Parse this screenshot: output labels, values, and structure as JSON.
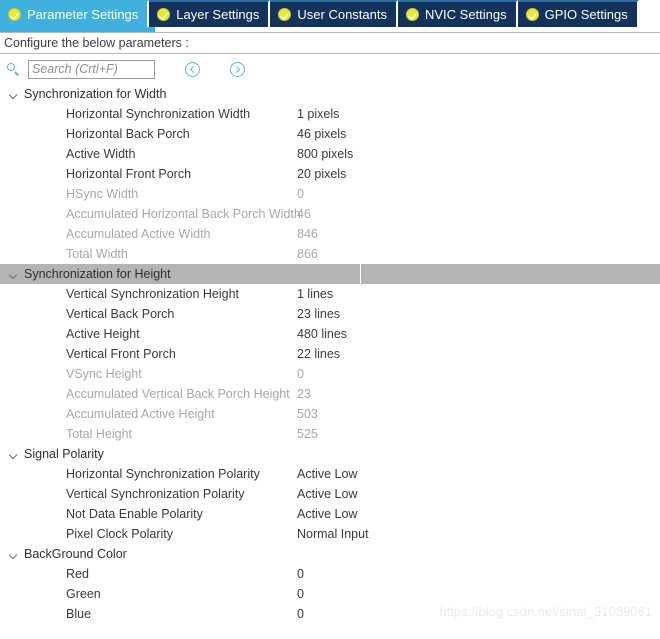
{
  "tabs": [
    {
      "label": "Parameter Settings",
      "active": true,
      "icon": "check-circle-icon"
    },
    {
      "label": "Layer Settings",
      "active": false,
      "icon": "check-circle-icon"
    },
    {
      "label": "User Constants",
      "active": false,
      "icon": "check-circle-icon"
    },
    {
      "label": "NVIC Settings",
      "active": false,
      "icon": "check-circle-icon"
    },
    {
      "label": "GPIO Settings",
      "active": false,
      "icon": "check-circle-icon"
    }
  ],
  "configure_bar": {
    "text": "Configure the below parameters :"
  },
  "search": {
    "placeholder": "Search (Crtl+F)",
    "value": "",
    "icon": "search-icon",
    "prev_icon": "chevron-left-circle-icon",
    "next_icon": "chevron-right-circle-icon"
  },
  "groups": [
    {
      "label": "Synchronization for Width",
      "selected": false,
      "rows": [
        {
          "name": "Horizontal Synchronization Width",
          "value": "1 pixels",
          "disabled": false
        },
        {
          "name": "Horizontal Back Porch",
          "value": "46 pixels",
          "disabled": false
        },
        {
          "name": "Active Width",
          "value": "800 pixels",
          "disabled": false
        },
        {
          "name": "Horizontal Front Porch",
          "value": "20 pixels",
          "disabled": false
        },
        {
          "name": "HSync Width",
          "value": "0",
          "disabled": true
        },
        {
          "name": "Accumulated Horizontal Back Porch Width",
          "value": "46",
          "disabled": true
        },
        {
          "name": "Accumulated Active Width",
          "value": "846",
          "disabled": true
        },
        {
          "name": "Total Width",
          "value": "866",
          "disabled": true
        }
      ]
    },
    {
      "label": "Synchronization for Height",
      "selected": true,
      "rows": [
        {
          "name": "Vertical Synchronization Height",
          "value": "1 lines",
          "disabled": false
        },
        {
          "name": "Vertical Back Porch",
          "value": "23 lines",
          "disabled": false
        },
        {
          "name": "Active Height",
          "value": "480 lines",
          "disabled": false
        },
        {
          "name": "Vertical Front Porch",
          "value": "22 lines",
          "disabled": false
        },
        {
          "name": "VSync Height",
          "value": "0",
          "disabled": true
        },
        {
          "name": "Accumulated Vertical Back Porch Height",
          "value": "23",
          "disabled": true
        },
        {
          "name": "Accumulated Active Height",
          "value": "503",
          "disabled": true
        },
        {
          "name": "Total Height",
          "value": "525",
          "disabled": true
        }
      ]
    },
    {
      "label": "Signal Polarity",
      "selected": false,
      "rows": [
        {
          "name": "Horizontal Synchronization Polarity",
          "value": "Active Low",
          "disabled": false
        },
        {
          "name": "Vertical Synchronization Polarity",
          "value": "Active Low",
          "disabled": false
        },
        {
          "name": "Not Data Enable Polarity",
          "value": "Active Low",
          "disabled": false
        },
        {
          "name": "Pixel Clock Polarity",
          "value": "Normal Input",
          "disabled": false
        }
      ]
    },
    {
      "label": "BackGround Color",
      "selected": false,
      "rows": [
        {
          "name": "Red",
          "value": "0",
          "disabled": false
        },
        {
          "name": "Green",
          "value": "0",
          "disabled": false
        },
        {
          "name": "Blue",
          "value": "0",
          "disabled": false
        }
      ]
    }
  ],
  "watermark": {
    "text": "https://blog.csdn.net/sinat_31039061"
  },
  "colors": {
    "active_tab": "#40b0de",
    "inactive_tab": "#13325c",
    "selected_row": "#b4b4b4",
    "icon_yellow": "#e8e83c",
    "accent_blue": "#58b6e0"
  }
}
